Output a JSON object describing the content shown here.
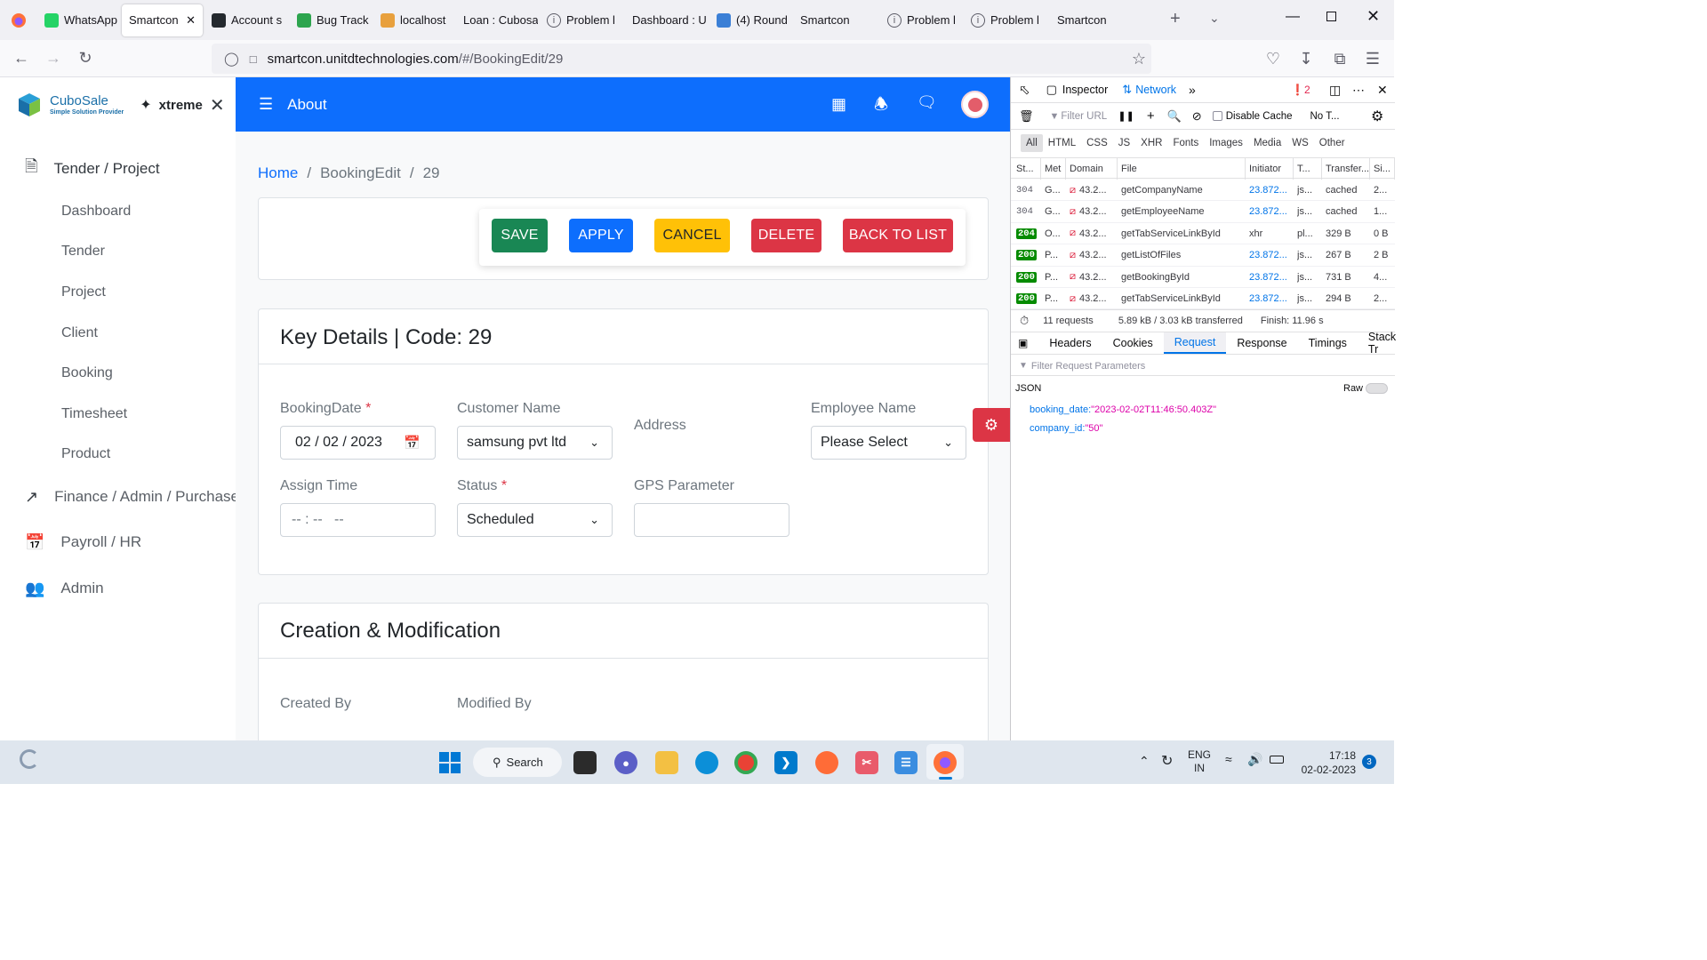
{
  "browser": {
    "tabs": [
      {
        "label": "WhatsApp",
        "icon": "whatsapp-icon",
        "color": "#25d366"
      },
      {
        "label": "Smartcon",
        "icon": "",
        "color": "",
        "active": true
      },
      {
        "label": "Account s",
        "icon": "github-icon",
        "color": "#24292e"
      },
      {
        "label": "Bug Track",
        "icon": "plus-icon",
        "color": "#2da44e"
      },
      {
        "label": "localhost",
        "icon": "pma-icon",
        "color": "#e8a03d"
      },
      {
        "label": "Loan : Cubosa",
        "icon": "",
        "color": ""
      },
      {
        "label": "Problem l",
        "icon": "info-icon",
        "color": "#5b5b66"
      },
      {
        "label": "Dashboard : U",
        "icon": "",
        "color": ""
      },
      {
        "label": "(4) Round",
        "icon": "round-icon",
        "color": "#3b7fd6"
      },
      {
        "label": "Smartcon",
        "icon": "",
        "color": ""
      },
      {
        "label": "Problem l",
        "icon": "info-icon",
        "color": "#5b5b66"
      },
      {
        "label": "Problem l",
        "icon": "info-icon",
        "color": "#5b5b66"
      },
      {
        "label": "Smartcon",
        "icon": "",
        "color": ""
      }
    ],
    "url_host": "smartcon.unitdtechnologies.com",
    "url_path": "/#/BookingEdit/29"
  },
  "sidebar": {
    "brand1": "CuboSale",
    "brand1_sub": "Simple Solution Provider",
    "brand2": "xtreme",
    "section_tender": "Tender / Project",
    "items": [
      "Dashboard",
      "Tender",
      "Project",
      "Client",
      "Booking",
      "Timesheet",
      "Product"
    ],
    "section_finance": "Finance / Admin / Purchase",
    "section_payroll": "Payroll / HR",
    "section_admin": "Admin"
  },
  "topbar": {
    "about": "About",
    "accent": "#0d6efd"
  },
  "breadcrumb": {
    "home": "Home",
    "page": "BookingEdit",
    "id": "29"
  },
  "actions": {
    "save": "SAVE",
    "apply": "APPLY",
    "cancel": "CANCEL",
    "delete": "DELETE",
    "back": "BACK TO LIST"
  },
  "key_details": {
    "title": "Key Details | Code: 29",
    "booking_date_label": "BookingDate",
    "booking_date_value": "02 / 02 / 2023",
    "customer_label": "Customer Name",
    "customer_value": "samsung pvt ltd",
    "address_label": "Address",
    "employee_label": "Employee Name",
    "employee_value": "Please Select",
    "assign_time_label": "Assign Time",
    "assign_time_value": "-- : --   --",
    "status_label": "Status",
    "status_value": "Scheduled",
    "gps_label": "GPS Parameter",
    "gps_value": "",
    "required_mark": "*"
  },
  "creation": {
    "title": "Creation & Modification",
    "created_by": "Created By",
    "modified_by": "Modified By"
  },
  "devtools": {
    "inspector": "Inspector",
    "network": "Network",
    "error_count": "2",
    "filter_placeholder": "Filter URL",
    "disable_cache": "Disable Cache",
    "throttle": "No T...",
    "filters": [
      "All",
      "HTML",
      "CSS",
      "JS",
      "XHR",
      "Fonts",
      "Images",
      "Media",
      "WS",
      "Other"
    ],
    "columns": [
      "St...",
      "Met",
      "Domain",
      "File",
      "Initiator",
      "T...",
      "Transfer...",
      "Si..."
    ],
    "requests": [
      {
        "status": "304",
        "ok": false,
        "method": "G...",
        "domain": "43.2...",
        "file": "getCompanyName",
        "initiator": "23.872...",
        "type": "js...",
        "transfer": "cached",
        "size": "2..."
      },
      {
        "status": "304",
        "ok": false,
        "method": "G...",
        "domain": "43.2...",
        "file": "getEmployeeName",
        "initiator": "23.872...",
        "type": "js...",
        "transfer": "cached",
        "size": "1..."
      },
      {
        "status": "204",
        "ok": true,
        "method": "O...",
        "domain": "43.2...",
        "file": "getTabServiceLinkById",
        "initiator": "xhr",
        "type": "pl...",
        "transfer": "329 B",
        "size": "0 B"
      },
      {
        "status": "200",
        "ok": true,
        "method": "P...",
        "domain": "43.2...",
        "file": "getListOfFiles",
        "initiator": "23.872...",
        "type": "js...",
        "transfer": "267 B",
        "size": "2 B"
      },
      {
        "status": "200",
        "ok": true,
        "method": "P...",
        "domain": "43.2...",
        "file": "getBookingById",
        "initiator": "23.872...",
        "type": "js...",
        "transfer": "731 B",
        "size": "4..."
      },
      {
        "status": "200",
        "ok": true,
        "method": "P...",
        "domain": "43.2...",
        "file": "getTabServiceLinkById",
        "initiator": "23.872...",
        "type": "js...",
        "transfer": "294 B",
        "size": "2..."
      }
    ],
    "summary_requests": "11 requests",
    "summary_size": "5.89 kB / 3.03 kB transferred",
    "summary_finish": "Finish: 11.96 s",
    "detail_tabs": [
      "Headers",
      "Cookies",
      "Request",
      "Response",
      "Timings",
      "Stack Tr"
    ],
    "filter_params": "Filter Request Parameters",
    "json_label": "JSON",
    "raw_label": "Raw",
    "params": [
      {
        "key": "booking_date",
        "value": "\"2023-02-02T11:46:50.403Z\""
      },
      {
        "key": "company_id",
        "value": "\"50\""
      }
    ]
  },
  "taskbar": {
    "search": "Search",
    "lang1": "ENG",
    "lang2": "IN",
    "time": "17:18",
    "date": "02-02-2023",
    "notif": "3"
  }
}
